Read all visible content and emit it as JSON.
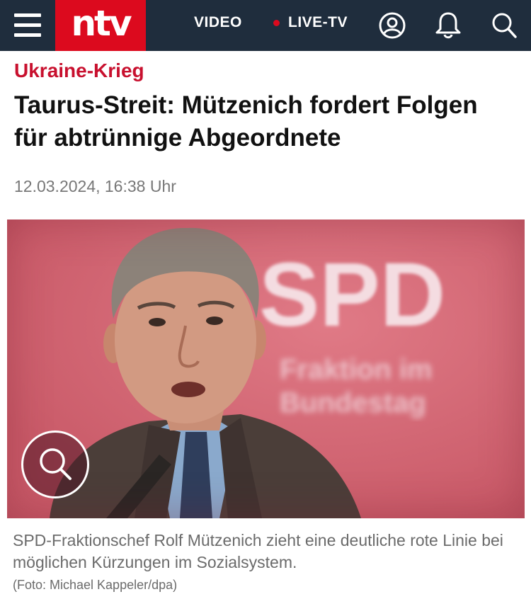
{
  "header": {
    "logo_text": "ntv",
    "nav_video": "VIDEO",
    "nav_live": "LIVE-TV",
    "icons": [
      "menu-icon",
      "user-icon",
      "bell-icon",
      "search-icon"
    ],
    "colors": {
      "background": "#1f2d3d",
      "brand_red": "#dc0a1e"
    }
  },
  "article": {
    "kicker": "Ukraine-Krieg",
    "headline": "Taurus-Streit: Mützenich fordert Folgen für abtrünnige Abgeordnete",
    "timestamp": "12.03.2024, 16:38 Uhr",
    "image": {
      "backdrop_text": "SPD",
      "backdrop_subtext": "Fraktion im Bundestag",
      "zoom_icon": "magnifier-icon"
    },
    "caption": "SPD-Fraktionschef Rolf Mützenich zieht eine deutliche rote Linie bei möglichen Kürzungen im Sozialsystem.",
    "credit": "(Foto: Michael Kappeler/dpa)"
  }
}
